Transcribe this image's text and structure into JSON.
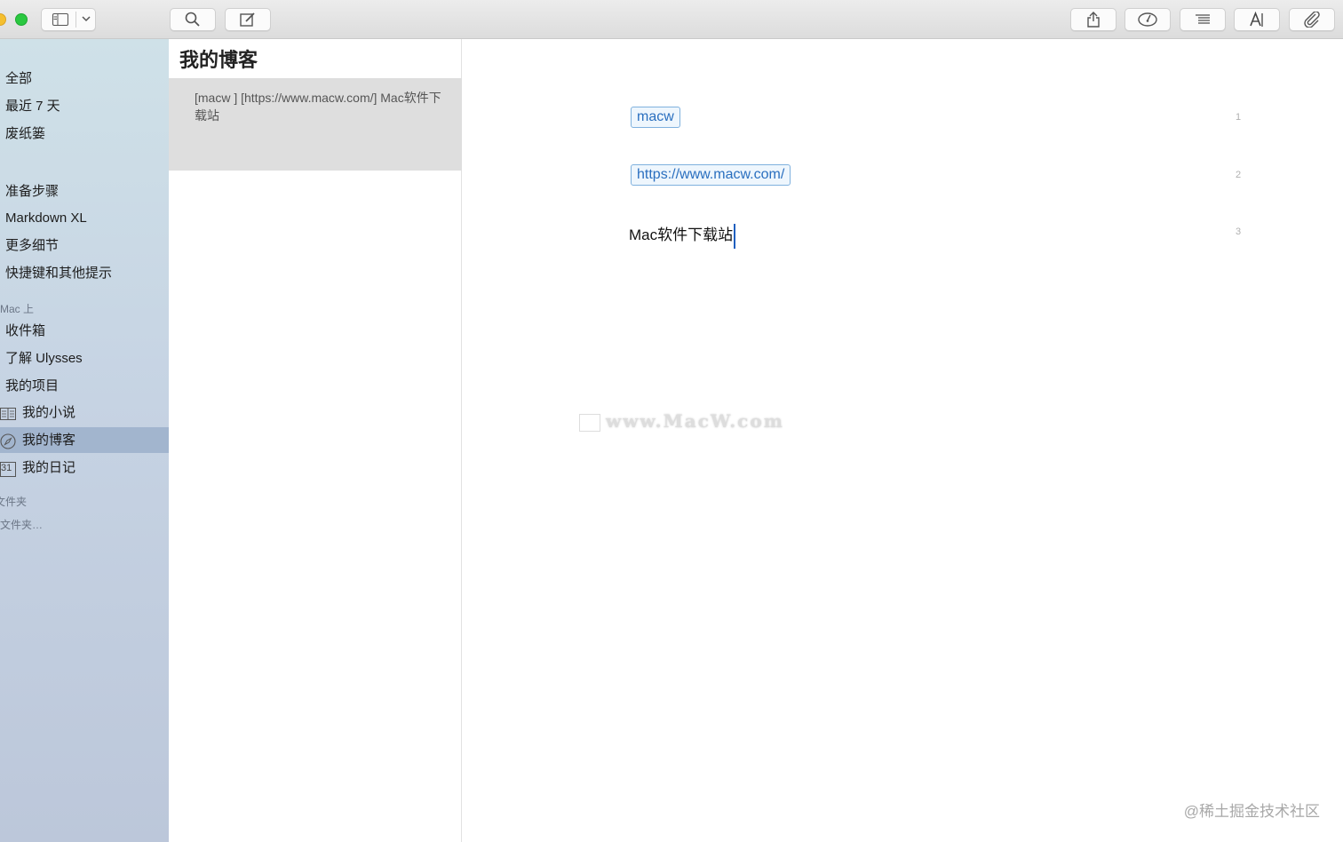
{
  "toolbar": {
    "left_buttons": [
      "sidebar-toggle",
      "view-menu",
      "search",
      "compose"
    ],
    "right_buttons": [
      "share",
      "goals",
      "outline",
      "font",
      "attachments"
    ]
  },
  "sidebar": {
    "library": [
      {
        "label": "全部"
      },
      {
        "label": "最近 7 天"
      },
      {
        "label": "废纸篓"
      }
    ],
    "filters": [
      {
        "label": "准备步骤"
      },
      {
        "label": "Markdown XL"
      },
      {
        "label": "更多细节"
      },
      {
        "label": "快捷键和其他提示"
      }
    ],
    "section_mac": "Mac 上",
    "mac_items": [
      {
        "label": "收件箱"
      },
      {
        "label": "了解 Ulysses"
      },
      {
        "label": "我的项目"
      }
    ],
    "project_items": [
      {
        "label": "我的小说",
        "icon": "book-icon"
      },
      {
        "label": "我的博客",
        "icon": "compass-icon",
        "selected": true
      },
      {
        "label": "我的日记",
        "icon": "calendar-icon",
        "icon_text": "31"
      }
    ],
    "section_folders": "文件夹",
    "add_folder": "文件夹…"
  },
  "sheetlist": {
    "title": "我的博客",
    "preview": "[macw ] [https://www.macw.com/] Mac软件下载站"
  },
  "editor": {
    "tag1": "macw",
    "tag2": "https://www.macw.com/",
    "line3": "Mac软件下载站",
    "line_numbers": [
      "1",
      "2",
      "3"
    ],
    "watermark": "www.MacW.com"
  },
  "credit": "@稀土掘金技术社区",
  "colors": {
    "sidebar_selected": "#a2b5ce",
    "tag_blue": "#2a6fbf",
    "caret_blue": "#1f5fbf"
  }
}
